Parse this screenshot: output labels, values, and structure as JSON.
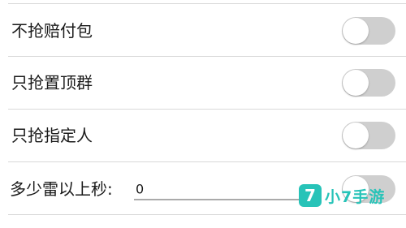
{
  "settings": [
    {
      "label": "不抢赔付包",
      "enabled": false
    },
    {
      "label": "只抢置顶群",
      "enabled": false
    },
    {
      "label": "只抢指定人",
      "enabled": false
    }
  ],
  "mine_seconds": {
    "label": "多少雷以上秒:",
    "value": "0",
    "toggle_enabled": false
  },
  "watermark": {
    "logo_char": "7",
    "text": "小7手游"
  },
  "colors": {
    "toggle_off": "#cfcfcf",
    "divider": "#d9d9d9",
    "watermark": "#27c3b8"
  }
}
